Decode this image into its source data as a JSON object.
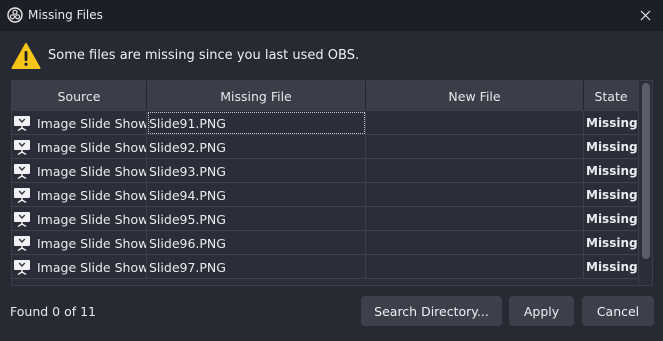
{
  "window": {
    "title": "Missing Files"
  },
  "warning": {
    "text": "Some files are missing since you last used OBS."
  },
  "table": {
    "columns": [
      "Source",
      "Missing File",
      "New File",
      "State"
    ],
    "rows": [
      {
        "source": "Image Slide Show",
        "missing_file": "Slide91.PNG",
        "new_file": "",
        "state": "Missing"
      },
      {
        "source": "Image Slide Show",
        "missing_file": "Slide92.PNG",
        "new_file": "",
        "state": "Missing"
      },
      {
        "source": "Image Slide Show",
        "missing_file": "Slide93.PNG",
        "new_file": "",
        "state": "Missing"
      },
      {
        "source": "Image Slide Show",
        "missing_file": "Slide94.PNG",
        "new_file": "",
        "state": "Missing"
      },
      {
        "source": "Image Slide Show",
        "missing_file": "Slide95.PNG",
        "new_file": "",
        "state": "Missing"
      },
      {
        "source": "Image Slide Show",
        "missing_file": "Slide96.PNG",
        "new_file": "",
        "state": "Missing"
      },
      {
        "source": "Image Slide Show",
        "missing_file": "Slide97.PNG",
        "new_file": "",
        "state": "Missing"
      }
    ]
  },
  "footer": {
    "found_text": "Found 0 of 11",
    "search_label": "Search Directory...",
    "apply_label": "Apply",
    "cancel_label": "Cancel"
  },
  "icons": {
    "app": "obs-logo-icon",
    "close": "close-icon",
    "warning": "warning-icon",
    "source": "slideshow-icon"
  },
  "colors": {
    "window_bg": "#272a33",
    "header_bg": "#3b3e48",
    "button_bg": "#3c404b",
    "warning_yellow": "#f5c518"
  }
}
